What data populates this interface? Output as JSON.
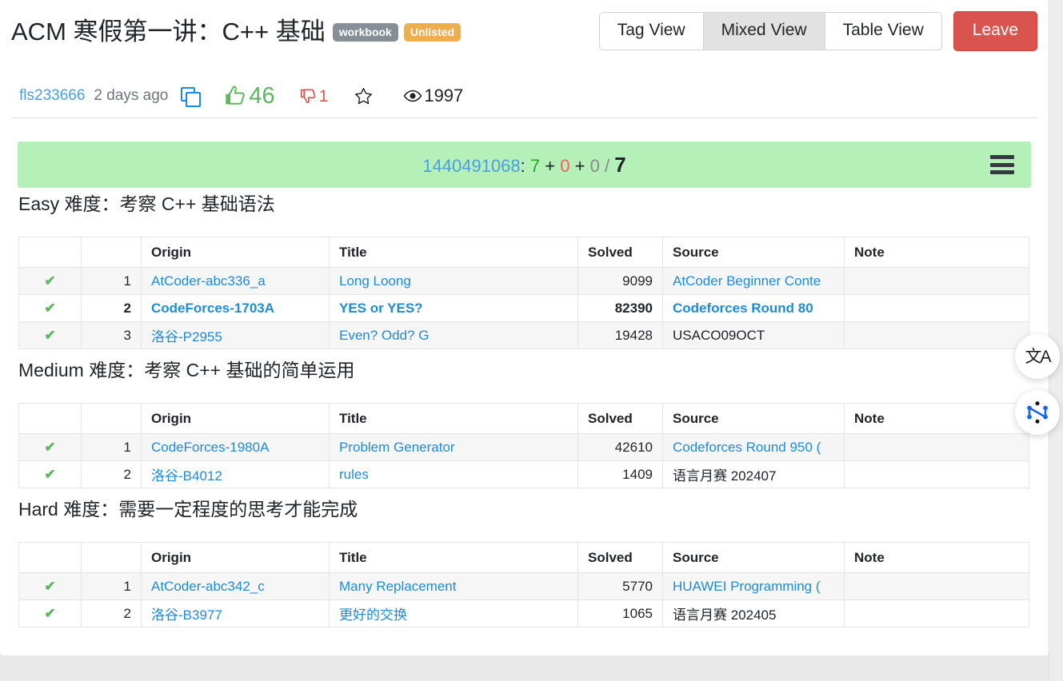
{
  "header": {
    "title": "ACM 寒假第一讲：C++ 基础",
    "badge_workbook": "workbook",
    "badge_unlisted": "Unlisted",
    "view_buttons": [
      {
        "label": "Tag View",
        "active": false
      },
      {
        "label": "Mixed View",
        "active": true
      },
      {
        "label": "Table View",
        "active": false
      }
    ],
    "leave_label": "Leave",
    "colors": {
      "badge_workbook_bg": "#868e96",
      "badge_unlisted_bg": "#f0ad4e",
      "leave_bg": "#d9534f",
      "active_tab_bg": "#e2e2e2"
    }
  },
  "meta": {
    "author": "fls233666",
    "time": "2 days ago",
    "copy_icon": "copy-icon",
    "like_icon": "thumbs-up-icon",
    "like_count": "46",
    "dislike_icon": "thumbs-down-icon",
    "dislike_count": "1",
    "star_icon": "star-outline-icon",
    "views_icon": "eye-icon",
    "views_count": "1997",
    "colors": {
      "like": "#5cb85c",
      "dislike": "#d9534f",
      "author_link": "#4a9fe0"
    }
  },
  "banner": {
    "id": "1440491068",
    "colon": ":",
    "accepted": "7",
    "plus1": "+",
    "wrong": "0",
    "plus2": "+",
    "untried": "0",
    "slash": "/",
    "total": "7",
    "menu_icon": "hamburger-menu-icon",
    "bg_color": "#b6f0b9"
  },
  "sections": [
    {
      "title": "Easy 难度：考察 C++ 基础语法",
      "has_sorters": true,
      "columns": [
        "",
        "",
        "Origin",
        "Title",
        "Solved",
        "Source",
        "Note"
      ],
      "rows": [
        {
          "status": "✔",
          "num": "1",
          "origin": "AtCoder-abc336_a",
          "origin_link": true,
          "title": "Long Loong",
          "title_link": true,
          "solved": "9099",
          "source": "AtCoder Beginner Conte",
          "source_link": true,
          "note": "",
          "bold": false,
          "alt": true
        },
        {
          "status": "✔",
          "num": "2",
          "origin": "CodeForces-1703A",
          "origin_link": true,
          "title": "YES or YES?",
          "title_link": true,
          "solved": "82390",
          "source": "Codeforces Round 80",
          "source_link": true,
          "note": "",
          "bold": true,
          "alt": false
        },
        {
          "status": "✔",
          "num": "3",
          "origin": "洛谷-P2955",
          "origin_link": true,
          "title": "Even? Odd? G",
          "title_link": true,
          "solved": "19428",
          "source": "USACO09OCT",
          "source_link": false,
          "note": "",
          "bold": false,
          "alt": true
        }
      ]
    },
    {
      "title": "Medium 难度：考察 C++ 基础的简单运用",
      "has_sorters": false,
      "columns": [
        "",
        "",
        "Origin",
        "Title",
        "Solved",
        "Source",
        "Note"
      ],
      "rows": [
        {
          "status": "✔",
          "num": "1",
          "origin": "CodeForces-1980A",
          "origin_link": true,
          "title": "Problem Generator",
          "title_link": true,
          "solved": "42610",
          "source": "Codeforces Round 950 (",
          "source_link": true,
          "note": "",
          "bold": false,
          "alt": true
        },
        {
          "status": "✔",
          "num": "2",
          "origin": "洛谷-B4012",
          "origin_link": true,
          "title": "rules",
          "title_link": true,
          "solved": "1409",
          "source": "语言月赛 202407",
          "source_link": false,
          "note": "",
          "bold": false,
          "alt": false
        }
      ]
    },
    {
      "title": "Hard 难度：需要一定程度的思考才能完成",
      "has_sorters": false,
      "columns": [
        "",
        "",
        "Origin",
        "Title",
        "Solved",
        "Source",
        "Note"
      ],
      "rows": [
        {
          "status": "✔",
          "num": "1",
          "origin": "AtCoder-abc342_c",
          "origin_link": true,
          "title": "Many Replacement",
          "title_link": true,
          "solved": "5770",
          "source": "HUAWEI Programming (",
          "source_link": true,
          "note": "",
          "bold": false,
          "alt": true
        },
        {
          "status": "✔",
          "num": "2",
          "origin": "洛谷-B3977",
          "origin_link": true,
          "title": "更好的交换",
          "title_link": true,
          "solved": "1065",
          "source": "语言月赛 202405",
          "source_link": false,
          "note": "",
          "bold": false,
          "alt": false
        }
      ]
    }
  ],
  "floating": {
    "translate_icon": "translate-icon",
    "translate_glyph": "文A",
    "graph_icon": "graph-network-icon"
  }
}
